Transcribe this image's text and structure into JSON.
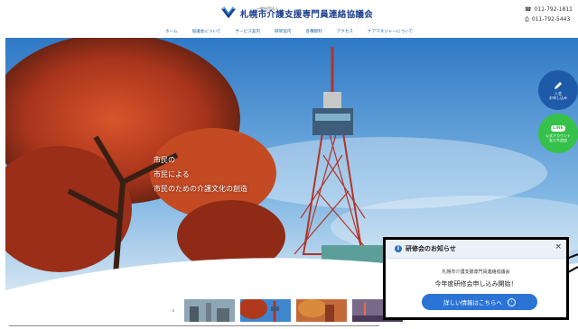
{
  "header": {
    "org_sub": "一般社団法人",
    "org_name": "札幌市介護支援専門員連絡協議会",
    "phone": "011-792-1811",
    "fax": "011-792-5443"
  },
  "nav": [
    "ホーム",
    "協議会について",
    "サービス案内",
    "研修案内",
    "各種資料",
    "アクセス",
    "ケアマネジャーについて"
  ],
  "hero": {
    "catch_lines": [
      "市民の",
      "市民による",
      "市民のための介護文化の創造"
    ]
  },
  "side_buttons": {
    "apply_label": "入会\nお申し込み",
    "line_label": "LINE",
    "line_sub": "公式アカウント\n友だち追加"
  },
  "thumbnails": {
    "prev": "‹",
    "count": 4
  },
  "popup": {
    "title": "研修会のお知らせ",
    "close": "×",
    "org": "札幌市介護支援専門員連絡協議会",
    "message": "今年度研修会申し込み開始！",
    "button": "詳しい情報はこちらへ",
    "button_icon": "›"
  },
  "colors": {
    "brand": "#1d3f8f",
    "nav": "#2563a8",
    "apply_bg": "#1e5aa8",
    "line_bg": "#35c14a",
    "popup_btn": "#2b74d6"
  }
}
